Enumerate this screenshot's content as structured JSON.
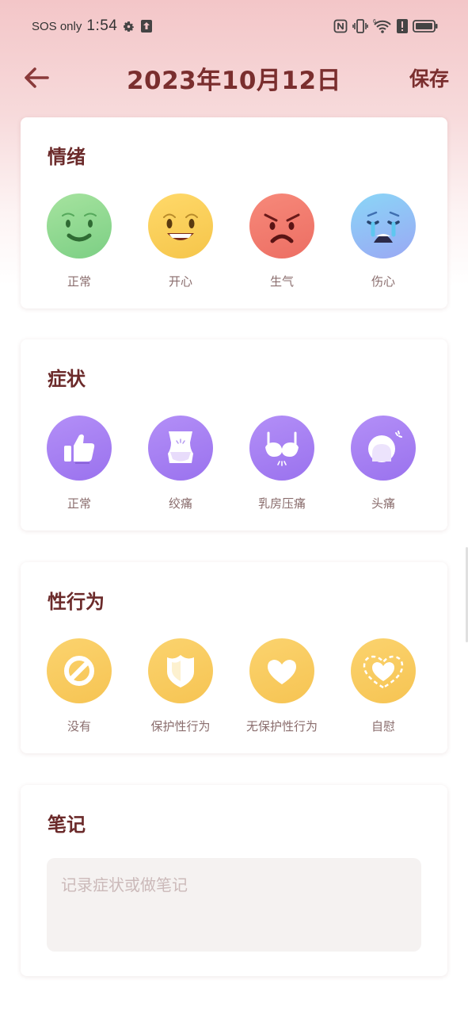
{
  "status_bar": {
    "carrier": "SOS only",
    "time": "1:54",
    "icons": [
      "gear-icon",
      "upload-icon",
      "nfc-icon",
      "vibrate-icon",
      "wifi-6-icon",
      "alert-icon",
      "battery-icon"
    ]
  },
  "header": {
    "title": "2023年10月12日",
    "save_label": "保存",
    "back_icon": "arrow-left-icon"
  },
  "colors": {
    "accent": "#7a2e2e",
    "mood_green": "#8fd98e",
    "mood_yellow": "#f8cd55",
    "mood_red": "#ee7466",
    "mood_blue": "#93bdf5",
    "symptom_purple": "#a47ef2",
    "sex_gold": "#f8cb5f"
  },
  "mood": {
    "title": "情绪",
    "options": [
      {
        "label": "正常",
        "icon": "neutral-face-icon"
      },
      {
        "label": "开心",
        "icon": "happy-face-icon"
      },
      {
        "label": "生气",
        "icon": "angry-face-icon"
      },
      {
        "label": "伤心",
        "icon": "crying-face-icon"
      }
    ]
  },
  "symptoms": {
    "title": "症状",
    "options": [
      {
        "label": "正常",
        "icon": "thumbs-up-icon"
      },
      {
        "label": "绞痛",
        "icon": "abdomen-icon"
      },
      {
        "label": "乳房压痛",
        "icon": "bra-icon"
      },
      {
        "label": "头痛",
        "icon": "head-icon"
      }
    ]
  },
  "sex": {
    "title": "性行为",
    "options": [
      {
        "label": "没有",
        "icon": "no-icon"
      },
      {
        "label": "保护性行为",
        "icon": "shield-icon"
      },
      {
        "label": "无保护性行为",
        "icon": "heart-icon"
      },
      {
        "label": "自慰",
        "icon": "sparkle-heart-icon"
      }
    ]
  },
  "notes": {
    "title": "笔记",
    "placeholder": "记录症状或做笔记",
    "value": ""
  }
}
